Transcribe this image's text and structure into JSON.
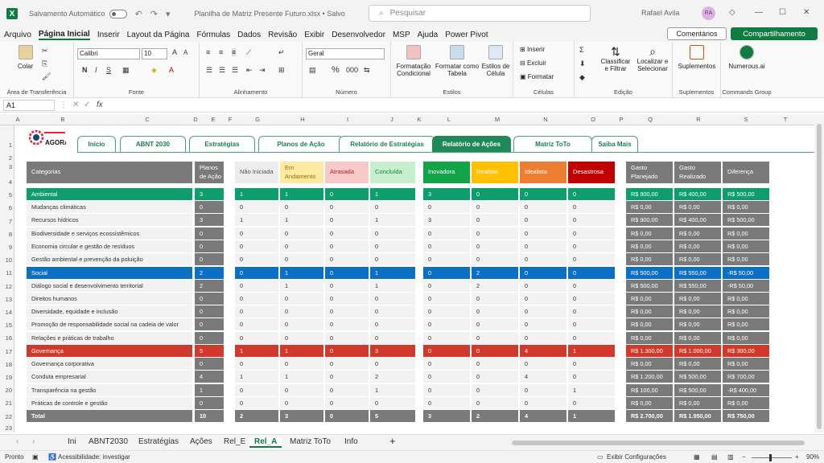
{
  "titlebar": {
    "autosave": "Salvamento Automático",
    "filename": "Planilha de Matriz Presente Futuro.xlsx • Salvo",
    "search": "Pesquisar",
    "user": "Rafael Avila",
    "initials": "RA"
  },
  "menu": [
    "Arquivo",
    "Página Inicial",
    "Inserir",
    "Layout da Página",
    "Fórmulas",
    "Dados",
    "Revisão",
    "Exibir",
    "Desenvolvedor",
    "MSP",
    "Ajuda",
    "Power Pivot"
  ],
  "menu_active": 1,
  "comments": "Comentários",
  "share": "Compartilhamento",
  "ribbon": {
    "paste": "Colar",
    "clipboard": "Área de Transferência",
    "font_name": "Calibri",
    "font_size": "10",
    "font_group": "Fonte",
    "align_group": "Alinhamento",
    "number_format": "Geral",
    "number_group": "Número",
    "cond_format": "Formatação Condicional",
    "format_table": "Formatar como Tabela",
    "cell_styles": "Estilos de Célula",
    "styles_group": "Estilos",
    "insert": "Inserir",
    "delete": "Excluir",
    "format": "Formatar",
    "cells_group": "Células",
    "sort_filter": "Classificar e Filtrar",
    "find_select": "Localizar e Selecionar",
    "editing_group": "Edição",
    "addins": "Suplementos",
    "addins_group": "Suplementos",
    "numerous": "Numerous.ai",
    "commands_group": "Commands Group"
  },
  "formula": {
    "cell": "A1",
    "fx": "fx"
  },
  "columns": [
    "A",
    "B",
    "C",
    "D",
    "E",
    "F",
    "G",
    "H",
    "I",
    "J",
    "K",
    "L",
    "M",
    "N",
    "O",
    "P",
    "Q",
    "R",
    "S",
    "T"
  ],
  "rows": [
    "1",
    "2",
    "3",
    "4",
    "5",
    "6",
    "7",
    "8",
    "9",
    "10",
    "11",
    "12",
    "13",
    "14",
    "15",
    "16",
    "17",
    "18",
    "19",
    "20",
    "21",
    "22",
    "23"
  ],
  "nav_tabs": [
    "Início",
    "ABNT 2030",
    "Estratégias",
    "Planos de Ação",
    "Relatório de Estratégias",
    "Relatório de Ações",
    "Matriz ToTo",
    "Saiba Mais"
  ],
  "nav_active": 5,
  "logo_text": "AGORA",
  "headers": {
    "categorias": "Categorias",
    "planos": "Planos de Ação",
    "nao_iniciada": "Não Iniciada",
    "em_andamento": "Em Andamento",
    "atrasada": "Atrasada",
    "concluida": "Concluída",
    "inovadora": "Inovadora",
    "realista": "Realista",
    "idealista": "Idealista",
    "desastrosa": "Desastrosa",
    "gasto_planejado": "Gasto Planejado",
    "gasto_realizado": "Gasto Realizado",
    "diferenca": "Diferença"
  },
  "table": [
    {
      "cat": "Ambiental",
      "type": "green",
      "p": "3",
      "s": [
        "1",
        "1",
        "0",
        "1"
      ],
      "q": [
        "3",
        "0",
        "0",
        "0"
      ],
      "g": [
        "R$ 900,00",
        "R$ 400,00",
        "R$ 500,00"
      ]
    },
    {
      "cat": "Mudanças climáticas",
      "type": "sub",
      "p": "0",
      "s": [
        "0",
        "0",
        "0",
        "0"
      ],
      "q": [
        "0",
        "0",
        "0",
        "0"
      ],
      "g": [
        "R$ 0,00",
        "R$ 0,00",
        "R$ 0,00"
      ]
    },
    {
      "cat": "Recursos hídricos",
      "type": "sub",
      "p": "3",
      "s": [
        "1",
        "1",
        "0",
        "1"
      ],
      "q": [
        "3",
        "0",
        "0",
        "0"
      ],
      "g": [
        "R$ 900,00",
        "R$ 400,00",
        "R$ 500,00"
      ]
    },
    {
      "cat": "Biodiversidade e serviços ecossistêmicos",
      "type": "sub",
      "p": "0",
      "s": [
        "0",
        "0",
        "0",
        "0"
      ],
      "q": [
        "0",
        "0",
        "0",
        "0"
      ],
      "g": [
        "R$ 0,00",
        "R$ 0,00",
        "R$ 0,00"
      ]
    },
    {
      "cat": "Economia circular e gestão de resíduos",
      "type": "sub",
      "p": "0",
      "s": [
        "0",
        "0",
        "0",
        "0"
      ],
      "q": [
        "0",
        "0",
        "0",
        "0"
      ],
      "g": [
        "R$ 0,00",
        "R$ 0,00",
        "R$ 0,00"
      ]
    },
    {
      "cat": "Gestão ambiental e prevenção da poluição",
      "type": "sub",
      "p": "0",
      "s": [
        "0",
        "0",
        "0",
        "0"
      ],
      "q": [
        "0",
        "0",
        "0",
        "0"
      ],
      "g": [
        "R$ 0,00",
        "R$ 0,00",
        "R$ 0,00"
      ]
    },
    {
      "cat": "Social",
      "type": "blue",
      "p": "2",
      "s": [
        "0",
        "1",
        "0",
        "1"
      ],
      "q": [
        "0",
        "2",
        "0",
        "0"
      ],
      "g": [
        "R$ 500,00",
        "R$ 550,00",
        "-R$ 50,00"
      ]
    },
    {
      "cat": "Diálogo social e desenvolvimento territorial",
      "type": "sub",
      "p": "2",
      "s": [
        "0",
        "1",
        "0",
        "1"
      ],
      "q": [
        "0",
        "2",
        "0",
        "0"
      ],
      "g": [
        "R$ 500,00",
        "R$ 550,00",
        "-R$ 50,00"
      ]
    },
    {
      "cat": "Direitos humanos",
      "type": "sub",
      "p": "0",
      "s": [
        "0",
        "0",
        "0",
        "0"
      ],
      "q": [
        "0",
        "0",
        "0",
        "0"
      ],
      "g": [
        "R$ 0,00",
        "R$ 0,00",
        "R$ 0,00"
      ]
    },
    {
      "cat": "Diversidade, equidade e inclusão",
      "type": "sub",
      "p": "0",
      "s": [
        "0",
        "0",
        "0",
        "0"
      ],
      "q": [
        "0",
        "0",
        "0",
        "0"
      ],
      "g": [
        "R$ 0,00",
        "R$ 0,00",
        "R$ 0,00"
      ]
    },
    {
      "cat": "Promoção de responsabilidade social na cadeia de valor",
      "type": "sub",
      "p": "0",
      "s": [
        "0",
        "0",
        "0",
        "0"
      ],
      "q": [
        "0",
        "0",
        "0",
        "0"
      ],
      "g": [
        "R$ 0,00",
        "R$ 0,00",
        "R$ 0,00"
      ]
    },
    {
      "cat": "Relações e práticas de trabalho",
      "type": "sub",
      "p": "0",
      "s": [
        "0",
        "0",
        "0",
        "0"
      ],
      "q": [
        "0",
        "0",
        "0",
        "0"
      ],
      "g": [
        "R$ 0,00",
        "R$ 0,00",
        "R$ 0,00"
      ]
    },
    {
      "cat": "Governança",
      "type": "red",
      "p": "5",
      "s": [
        "1",
        "1",
        "0",
        "3"
      ],
      "q": [
        "0",
        "0",
        "4",
        "1"
      ],
      "g": [
        "R$ 1.300,00",
        "R$ 1.000,00",
        "R$ 300,00"
      ]
    },
    {
      "cat": "Governança corporativa",
      "type": "sub",
      "p": "0",
      "s": [
        "0",
        "0",
        "0",
        "0"
      ],
      "q": [
        "0",
        "0",
        "0",
        "0"
      ],
      "g": [
        "R$ 0,00",
        "R$ 0,00",
        "R$ 0,00"
      ]
    },
    {
      "cat": "Conduta empresarial",
      "type": "sub",
      "p": "4",
      "s": [
        "1",
        "1",
        "0",
        "2"
      ],
      "q": [
        "0",
        "0",
        "4",
        "0"
      ],
      "g": [
        "R$ 1.200,00",
        "R$ 500,00",
        "R$ 700,00"
      ]
    },
    {
      "cat": "Transparência na gestão",
      "type": "sub",
      "p": "1",
      "s": [
        "0",
        "0",
        "0",
        "1"
      ],
      "q": [
        "0",
        "0",
        "0",
        "1"
      ],
      "g": [
        "R$ 100,00",
        "R$ 500,00",
        "-R$ 400,00"
      ]
    },
    {
      "cat": "Práticas de controle e gestão",
      "type": "sub",
      "p": "0",
      "s": [
        "0",
        "0",
        "0",
        "0"
      ],
      "q": [
        "0",
        "0",
        "0",
        "0"
      ],
      "g": [
        "R$ 0,00",
        "R$ 0,00",
        "R$ 0,00"
      ]
    },
    {
      "cat": "Total",
      "type": "total",
      "p": "10",
      "s": [
        "2",
        "3",
        "0",
        "5"
      ],
      "q": [
        "3",
        "2",
        "4",
        "1"
      ],
      "g": [
        "R$ 2.700,00",
        "R$ 1.950,00",
        "R$ 750,00"
      ]
    }
  ],
  "colors": {
    "green": "#0f9d6b",
    "blue": "#0b6fc4",
    "red": "#d0392b",
    "total": "#7a7a7a",
    "nao_iniciada": "#ececec",
    "em_andamento": "#fde9a0",
    "atrasada": "#f8c9c9",
    "concluida": "#c6efce",
    "inovadora": "#13a44a",
    "realista": "#ffc000",
    "idealista": "#ed7d31",
    "desastrosa": "#c00000"
  },
  "sheet_tabs": [
    "Ini",
    "ABNT2030",
    "Estratégias",
    "Ações",
    "Rel_E",
    "Rel_A",
    "Matriz ToTo",
    "Info"
  ],
  "sheet_active": 5,
  "status": {
    "ready": "Pronto",
    "accessibility": "Acessibilidade: investigar",
    "display": "Exibir Configurações",
    "zoom": "90%"
  }
}
